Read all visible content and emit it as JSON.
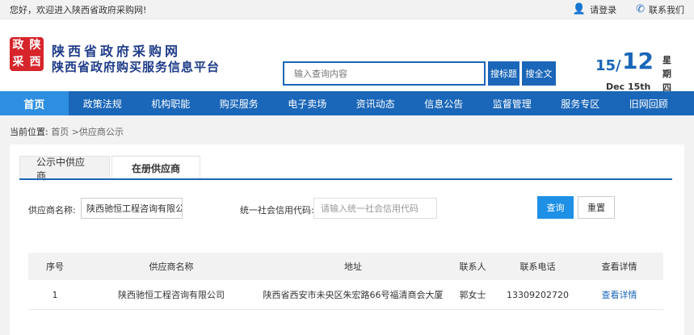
{
  "topbar": {
    "welcome": "您好，欢迎进入陕西省政府采购网!",
    "login": "请登录",
    "contact": "联系我们"
  },
  "header": {
    "logo_chars": [
      "政",
      "陕",
      "采",
      "西"
    ],
    "title": "陕西省政府采购网",
    "subtitle": "陕西省政府购买服务信息平台",
    "search_placeholder": "输入查询内容",
    "search_title_btn": "搜标题",
    "search_full_btn": "搜全文",
    "date_day": "15/",
    "date_month": "12",
    "date_en": "Dec 15th",
    "weekday": "星期四"
  },
  "nav": {
    "items": [
      "首页",
      "政策法规",
      "机构职能",
      "购买服务",
      "电子卖场",
      "资讯动态",
      "信息公告",
      "监督管理",
      "服务专区",
      "旧网回顾"
    ]
  },
  "breadcrumb": {
    "label": "当前位置:",
    "path": "首页 >供应商公示"
  },
  "tabs": [
    "公示中供应商",
    "在册供应商"
  ],
  "filters": {
    "name_label": "供应商名称:",
    "name_value": "陕西驰恒工程咨询有限公司",
    "code_label": "统一社会信用代码:",
    "code_placeholder": "请输入统一社会信用代码",
    "query_btn": "查询",
    "reset_btn": "重置"
  },
  "table": {
    "headers": [
      "序号",
      "供应商名称",
      "地址",
      "联系人",
      "联系电话",
      "查看详情"
    ],
    "rows": [
      [
        "1",
        "陕西驰恒工程咨询有限公司",
        "陕西省西安市未央区朱宏路66号福清商会大厦",
        "郭女士",
        "13309202720",
        "查看详情"
      ]
    ]
  }
}
